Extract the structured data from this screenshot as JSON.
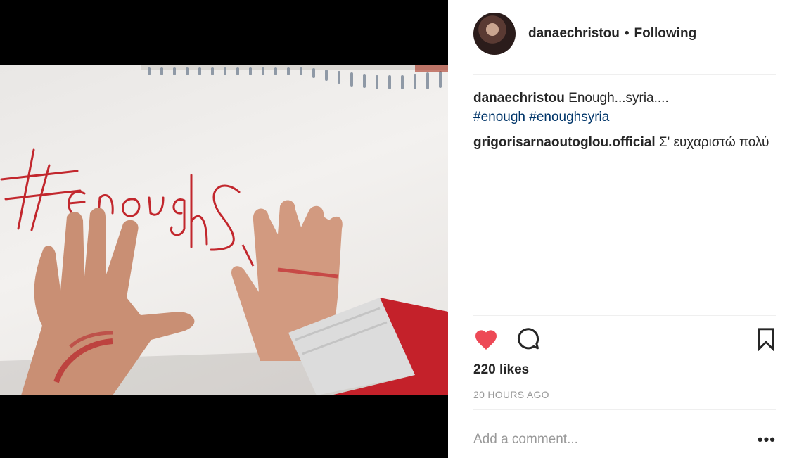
{
  "post": {
    "image_alt": "Child's hands on paper with #enoughsyria written in red marker"
  },
  "header": {
    "username": "danaechristou",
    "separator": "•",
    "follow_state": "Following"
  },
  "comments": [
    {
      "user": "danaechristou",
      "text": "Enough...syria....",
      "hashtags": [
        "#enough",
        "#enoughsyria"
      ]
    },
    {
      "user": "grigorisarnaoutoglou.official",
      "text": "Σ' ευχαριστώ πολύ"
    }
  ],
  "actions": {
    "like_icon": "heart-filled-icon",
    "comment_icon": "comment-bubble-icon",
    "save_icon": "bookmark-icon",
    "like_color": "#ed4956"
  },
  "likes": "220 likes",
  "timestamp": "20 HOURS AGO",
  "add_comment": {
    "placeholder": "Add a comment...",
    "more_label": "•••"
  }
}
